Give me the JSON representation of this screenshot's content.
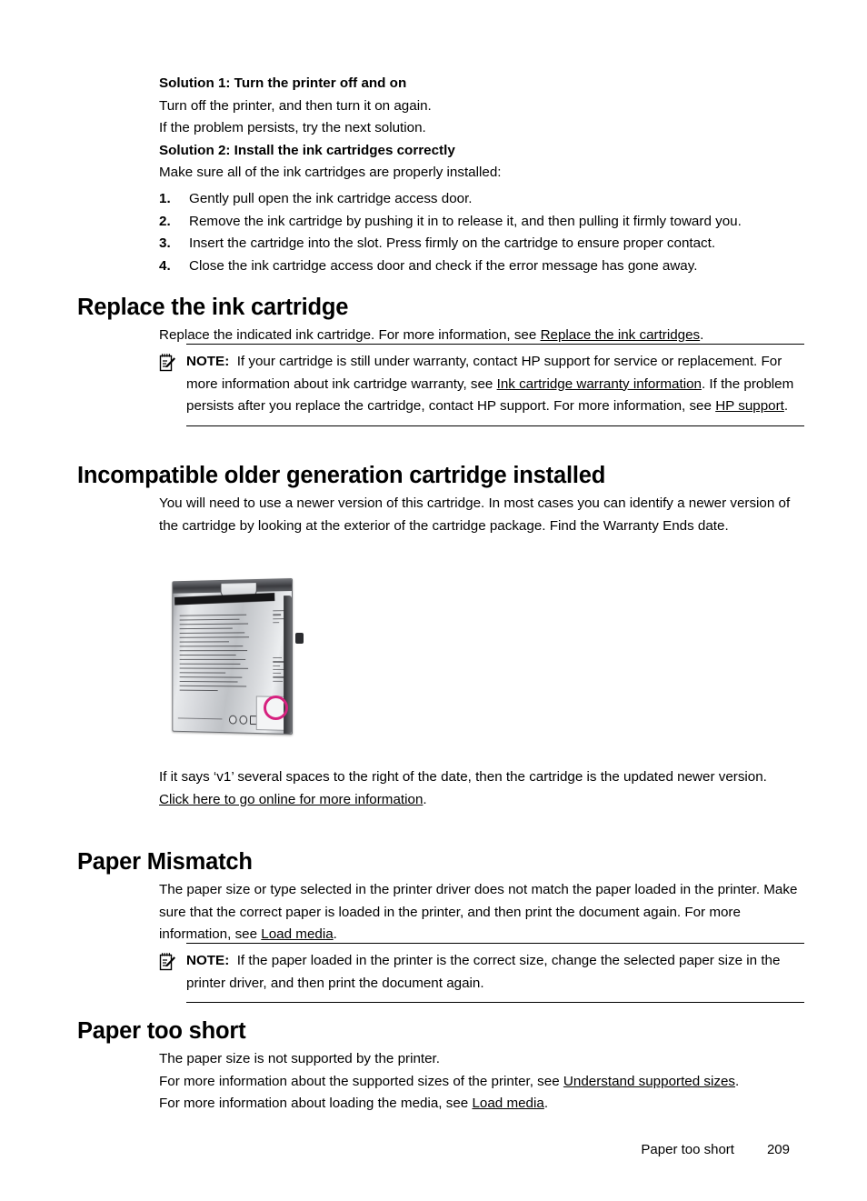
{
  "page": {
    "footer_section_title": "Paper too short",
    "page_number": "209"
  },
  "intro": {
    "solution1_heading": "Solution 1: Turn the printer off and on",
    "solution1_line1": "Turn off the printer, and then turn it on again.",
    "solution1_line2": "If the problem persists, try the next solution.",
    "solution2_heading": "Solution 2: Install the ink cartridges correctly",
    "solution2_intro": "Make sure all of the ink cartridges are properly installed:",
    "steps": [
      "Gently pull open the ink cartridge access door.",
      "Remove the ink cartridge by pushing it in to release it, and then pulling it firmly toward you.",
      "Insert the cartridge into the slot. Press firmly on the cartridge to ensure proper contact.",
      "Close the ink cartridge access door and check if the error message has gone away."
    ]
  },
  "replace_cartridge": {
    "heading": "Replace the ink cartridge",
    "para_before_link": "Replace the indicated ink cartridge. For more information, see ",
    "para_link": "Replace the ink cartridges",
    "para_after_link": ".",
    "note": {
      "label": "NOTE:",
      "icon": "note-pencil-icon",
      "text_1": "If your cartridge is still under warranty, contact HP support for service or replacement. For more information about ink cartridge warranty, see ",
      "link_1": "Ink cartridge warranty information",
      "text_2": ". If the problem persists after you replace the cartridge, contact HP support. For more information, see ",
      "link_2": "HP support",
      "text_3": "."
    }
  },
  "incompatible_cartridge": {
    "heading": "Incompatible older generation cartridge installed",
    "para": "You will need to use a newer version of this cartridge. In most cases you can identify a newer version of the cartridge by looking at the exterior of the cartridge package. Find the Warranty Ends date.",
    "figure": {
      "name": "ink-cartridge-package-photo",
      "highlight_color": "#D6217F",
      "description": "Ink cartridge foil package with hang hole and highlighted warranty date area"
    },
    "para_after_image": "If it says ‘v1’ several spaces to the right of the date, then the cartridge is the updated newer version.",
    "online_link": "Click here to go online for more information",
    "online_link_suffix": "."
  },
  "paper_mismatch": {
    "heading": "Paper Mismatch",
    "para_before_link": "The paper size or type selected in the printer driver does not match the paper loaded in the printer. Make sure that the correct paper is loaded in the printer, and then print the document again. For more information, see ",
    "para_link": "Load media",
    "para_after_link": ".",
    "note": {
      "label": "NOTE:",
      "icon": "note-pencil-icon",
      "text": "If the paper loaded in the printer is the correct size, change the selected paper size in the printer driver, and then print the document again."
    }
  },
  "paper_too_short": {
    "heading": "Paper too short",
    "line1": "The paper size is not supported by the printer.",
    "line2_before_link": "For more information about the supported sizes of the printer, see ",
    "line2_link": "Understand supported sizes",
    "line2_after_link": ".",
    "line3_before_link": "For more information about loading the media, see ",
    "line3_link": "Load media",
    "line3_after_link": "."
  }
}
